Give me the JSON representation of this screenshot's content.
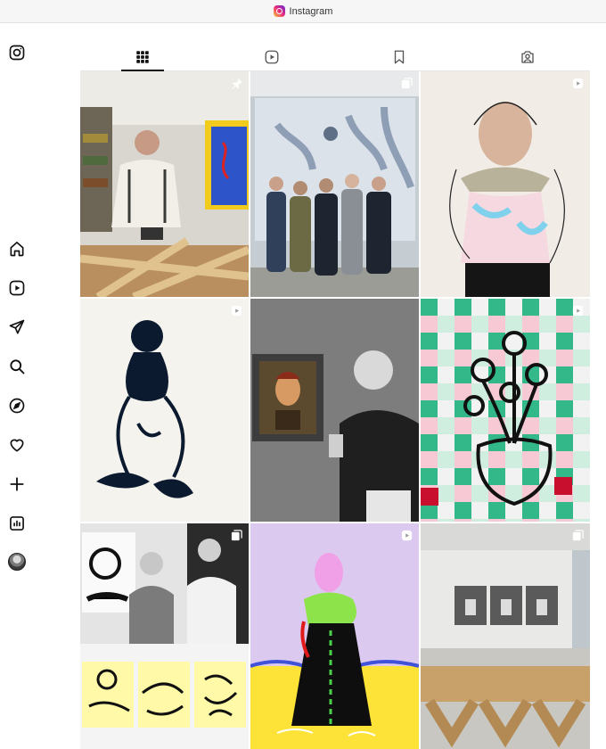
{
  "browser": {
    "title": "Instagram"
  },
  "nav": {
    "items": [
      {
        "name": "instagram-logo-icon"
      },
      {
        "name": "home-icon"
      },
      {
        "name": "reels-icon"
      },
      {
        "name": "messages-icon"
      },
      {
        "name": "search-icon"
      },
      {
        "name": "explore-icon"
      },
      {
        "name": "notifications-icon"
      },
      {
        "name": "create-icon"
      },
      {
        "name": "insights-icon"
      },
      {
        "name": "profile-avatar"
      }
    ]
  },
  "tabs": [
    {
      "name": "posts-grid-icon",
      "active": true
    },
    {
      "name": "reels-tab-icon",
      "active": false
    },
    {
      "name": "saved-tab-icon",
      "active": false
    },
    {
      "name": "tagged-tab-icon",
      "active": false
    }
  ],
  "posts": [
    {
      "name": "post-artist-workshop",
      "badge": "pinned-icon"
    },
    {
      "name": "post-group-photo-gallery",
      "badge": "carousel-icon"
    },
    {
      "name": "post-portrait-painting",
      "badge": "reel-icon"
    },
    {
      "name": "post-ink-figure",
      "badge": "reel-icon"
    },
    {
      "name": "post-museum-visit",
      "badge": ""
    },
    {
      "name": "post-checkered-flower-painting",
      "badge": "reel-icon"
    },
    {
      "name": "post-exhibition-collage",
      "badge": "carousel-icon"
    },
    {
      "name": "post-lilac-figure-painting",
      "badge": "reel-icon"
    },
    {
      "name": "post-gallery-installation",
      "badge": "carousel-icon"
    }
  ],
  "colors": {
    "text": "#111111",
    "divider": "#e6e6e6",
    "accent_gradient": [
      "#f9ce34",
      "#ee2a7b",
      "#6228d7"
    ]
  }
}
